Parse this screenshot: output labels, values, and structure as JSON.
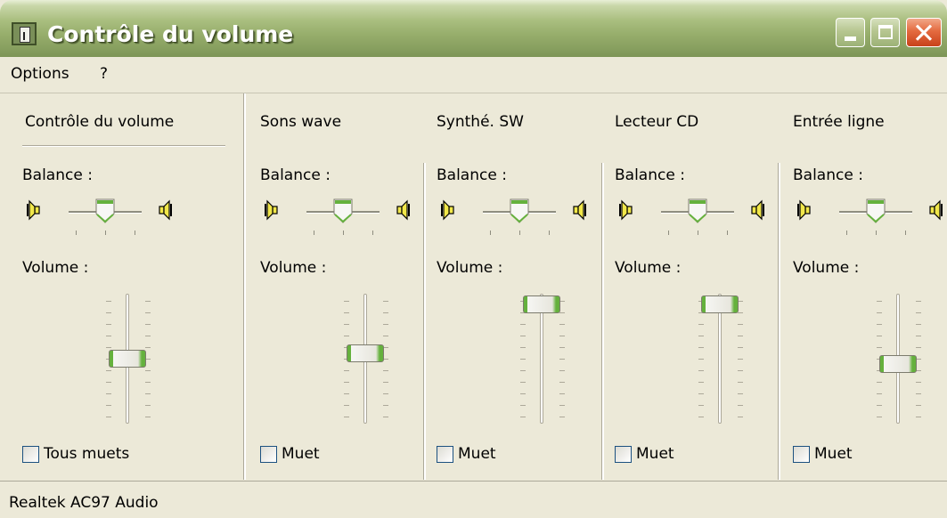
{
  "window": {
    "title": "Contrôle du volume"
  },
  "menu": {
    "items": [
      "Options",
      "?"
    ]
  },
  "labels": {
    "balance": "Balance :",
    "volume": "Volume :"
  },
  "channels": [
    {
      "name": "Contrôle du volume",
      "balance": 0.5,
      "volume": 0.5,
      "mute_label": "Tous muets",
      "muted": false
    },
    {
      "name": "Sons wave",
      "balance": 0.5,
      "volume": 0.55,
      "mute_label": "Muet",
      "muted": false
    },
    {
      "name": "Synthé. SW",
      "balance": 0.5,
      "volume": 1.0,
      "mute_label": "Muet",
      "muted": false
    },
    {
      "name": "Lecteur CD",
      "balance": 0.5,
      "volume": 1.0,
      "mute_label": "Muet",
      "muted": false
    },
    {
      "name": "Entrée ligne",
      "balance": 0.5,
      "volume": 0.45,
      "mute_label": "Muet",
      "muted": false
    }
  ],
  "status": {
    "device": "Realtek AC97 Audio"
  },
  "colors": {
    "title_bar": "#97ae6c",
    "close_button": "#e46a3f",
    "slider_accent": "#65b13d",
    "window_bg": "#ece9d8"
  }
}
